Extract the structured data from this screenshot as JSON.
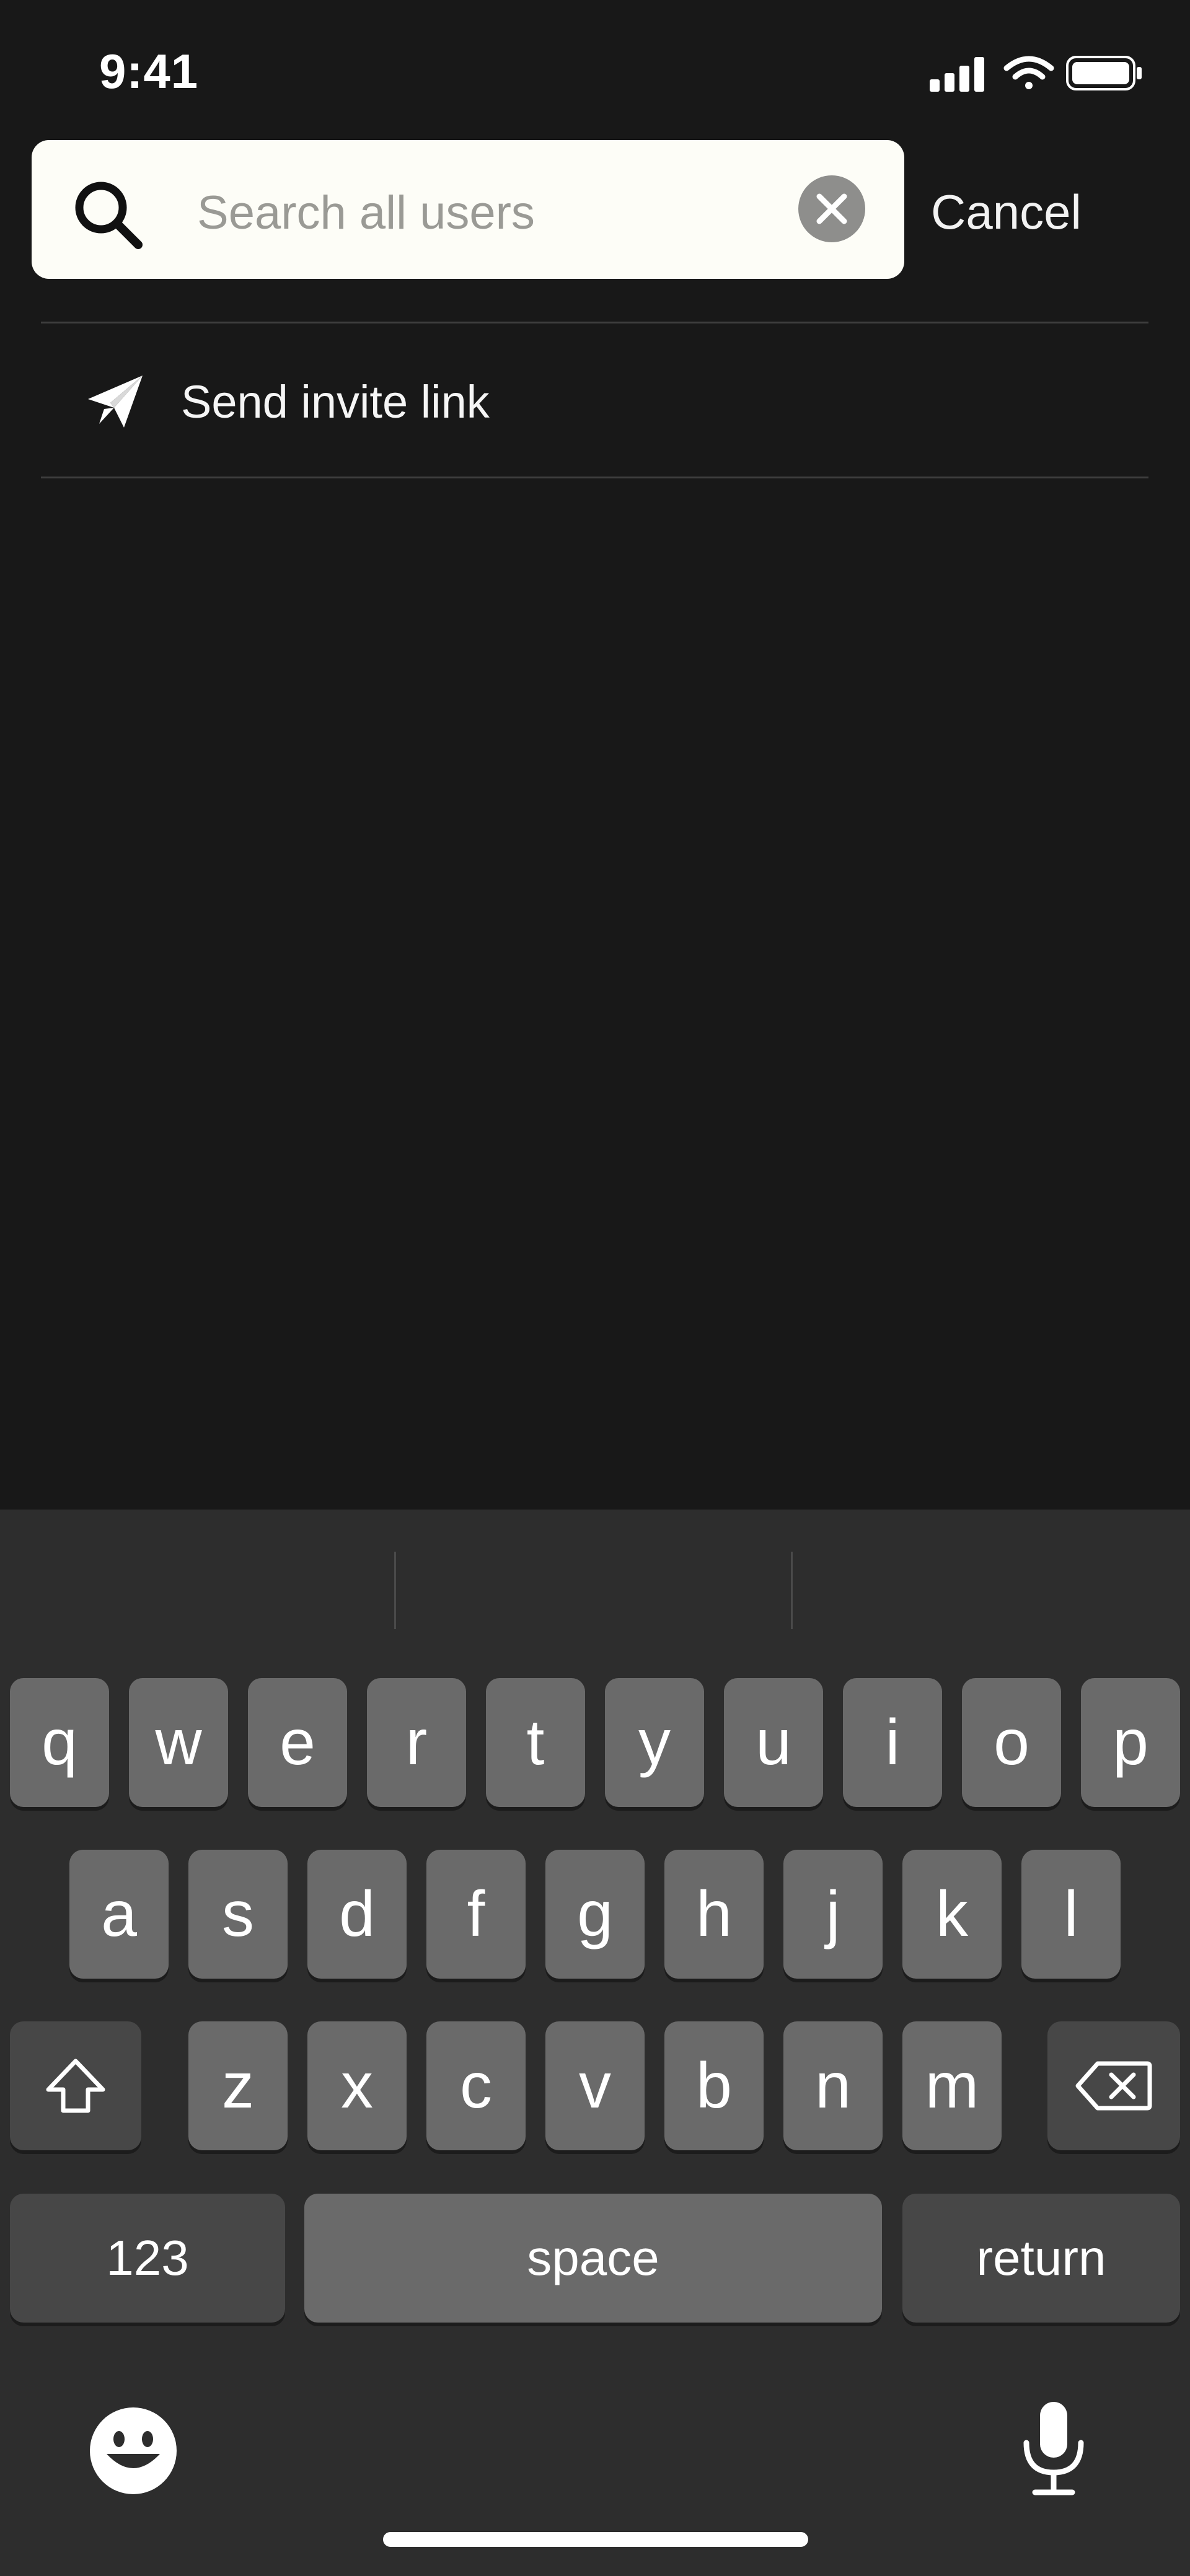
{
  "status_bar": {
    "time": "9:41",
    "icons": [
      "cellular-signal-icon",
      "wifi-icon",
      "battery-icon"
    ]
  },
  "search": {
    "placeholder": "Search all users",
    "value": "",
    "cancel_label": "Cancel"
  },
  "actions": [
    {
      "label": "Send invite link",
      "icon": "paper-plane-icon"
    }
  ],
  "keyboard": {
    "row1": [
      "q",
      "w",
      "e",
      "r",
      "t",
      "y",
      "u",
      "i",
      "o",
      "p"
    ],
    "row2": [
      "a",
      "s",
      "d",
      "f",
      "g",
      "h",
      "j",
      "k",
      "l"
    ],
    "row3": [
      "z",
      "x",
      "c",
      "v",
      "b",
      "n",
      "m"
    ],
    "numbers_label": "123",
    "space_label": "space",
    "return_label": "return"
  },
  "colors": {
    "background": "#181818",
    "search_field": "#fdfdf7",
    "keyboard": "#2d2d2d",
    "key": "#6a6a6a",
    "key_dark": "#474747"
  }
}
